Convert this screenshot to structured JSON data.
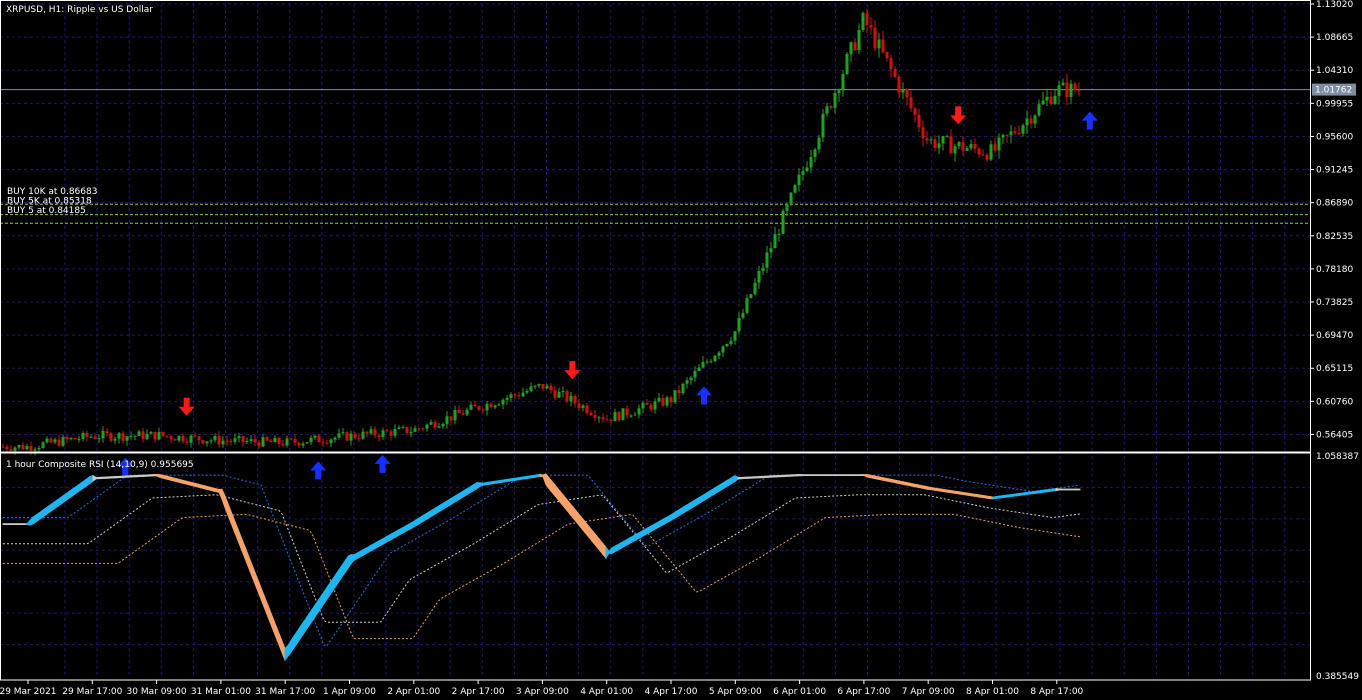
{
  "symbol_title": "XRPUSD, H1:  Ripple vs US Dollar",
  "indicator_title": "1 hour Composite RSI (14,10,9) 0.955695",
  "colors": {
    "background": "#000000",
    "grid": "#1a1a66",
    "bull": "#1fa31f",
    "bear": "#d01010",
    "buy_arrow": "#1530ff",
    "sell_arrow": "#ff1a1a",
    "buy_line": "#7fd04a",
    "rsi_up": "#1fb6f0",
    "rsi_down": "#f4a26a",
    "rsi_mid": "#c8c8c8",
    "bid_line": "#7f8da0",
    "signal_blue": "#2d6fd9",
    "signal_orange": "#e8a060",
    "signal_white": "#cfcfcf"
  },
  "buy_levels": [
    {
      "label": "BUY 10K at 0.86683",
      "price": 0.86683
    },
    {
      "label": "BUY 5K at 0.85318",
      "price": 0.85318
    },
    {
      "label": "BUY 5 at 0.84185",
      "price": 0.84185
    }
  ],
  "price_axis_labels": [
    "1.13020",
    "1.08665",
    "1.04310",
    "0.99955",
    "0.95600",
    "0.91245",
    "0.86890",
    "0.82535",
    "0.78180",
    "0.73825",
    "0.69470",
    "0.65115",
    "0.60760",
    "0.56405"
  ],
  "current_price": "1.01762",
  "indicator_axis_labels": [
    "1.058387",
    "0.385549"
  ],
  "time_labels": [
    "29 Mar 2021",
    "29 Mar 17:00",
    "30 Mar 09:00",
    "31 Mar 01:00",
    "31 Mar 17:00",
    "1 Apr 09:00",
    "2 Apr 01:00",
    "2 Apr 17:00",
    "3 Apr 09:00",
    "4 Apr 01:00",
    "4 Apr 17:00",
    "5 Apr 09:00",
    "6 Apr 01:00",
    "6 Apr 17:00",
    "7 Apr 09:00",
    "8 Apr 01:00",
    "8 Apr 17:00"
  ],
  "chart_data": {
    "type": "candlestick",
    "title": "XRPUSD, H1:  Ripple vs US Dollar",
    "ylim": [
      0.5423,
      1.1302
    ],
    "close_waypoints": [
      [
        "29 Mar 2021",
        0.548
      ],
      [
        "29 Mar 17:00",
        0.562
      ],
      [
        "30 Mar 09:00",
        0.563
      ],
      [
        "31 Mar 01:00",
        0.556
      ],
      [
        "31 Mar 17:00",
        0.553
      ],
      [
        "1 Apr 09:00",
        0.562
      ],
      [
        "2 Apr 01:00",
        0.57
      ],
      [
        "2 Apr 17:00",
        0.6
      ],
      [
        "3 Apr 09:00",
        0.628
      ],
      [
        "4 Apr 01:00",
        0.585
      ],
      [
        "4 Apr 17:00",
        0.61
      ],
      [
        "5 Apr 09:00",
        0.7
      ],
      [
        "6 Apr 01:00",
        0.9
      ],
      [
        "6 Apr 17:00",
        1.11
      ],
      [
        "7 Apr 09:00",
        0.95
      ],
      [
        "8 Apr 01:00",
        0.935
      ],
      [
        "8 Apr 17:00",
        1.0176
      ]
    ],
    "sell_signals": [
      "30 Mar 09:00",
      "3 Apr 09:00",
      "7 Apr 09:00"
    ],
    "buy_signals": [
      "29 Mar 17:00",
      "31 Mar 17:00",
      "1 Apr 09:00",
      "4 Apr 17:00",
      "8 Apr 17:00"
    ],
    "indicator": {
      "name": "1 hour Composite RSI (14,10,9)",
      "value": 0.955695,
      "ylim": [
        0.385549,
        1.058387
      ],
      "waypoints": [
        [
          "29 Mar 2021",
          0.85
        ],
        [
          "29 Mar 17:00",
          0.99
        ],
        [
          "30 Mar 09:00",
          1.0
        ],
        [
          "31 Mar 01:00",
          0.95
        ],
        [
          "31 Mar 17:00",
          0.45
        ],
        [
          "1 Apr 09:00",
          0.74
        ],
        [
          "2 Apr 01:00",
          0.85
        ],
        [
          "2 Apr 17:00",
          0.97
        ],
        [
          "3 Apr 09:00",
          1.0
        ],
        [
          "4 Apr 01:00",
          0.76
        ],
        [
          "4 Apr 17:00",
          0.87
        ],
        [
          "5 Apr 09:00",
          0.99
        ],
        [
          "6 Apr 01:00",
          1.0
        ],
        [
          "6 Apr 17:00",
          1.0
        ],
        [
          "7 Apr 09:00",
          0.96
        ],
        [
          "8 Apr 01:00",
          0.93
        ],
        [
          "8 Apr 17:00",
          0.956
        ]
      ]
    }
  }
}
